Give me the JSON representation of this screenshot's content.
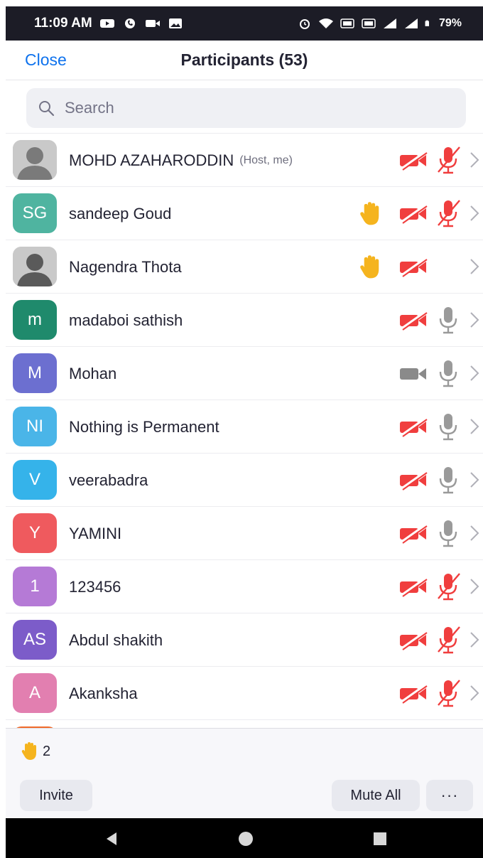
{
  "status_bar": {
    "time": "11:09 AM",
    "battery": "79%"
  },
  "header": {
    "close_label": "Close",
    "title": "Participants (53)"
  },
  "search": {
    "placeholder": "Search"
  },
  "participants": [
    {
      "name": "MOHD AZAHARODDIN",
      "tag": "(Host, me)",
      "initials": "",
      "avatar": "photo",
      "color": "#7a7a7a",
      "hand": false,
      "video": "off",
      "audio": "muted"
    },
    {
      "name": "sandeep Goud",
      "tag": "",
      "initials": "SG",
      "avatar": "initials",
      "color": "#4fb4a0",
      "hand": true,
      "video": "off",
      "audio": "muted"
    },
    {
      "name": "Nagendra Thota",
      "tag": "",
      "initials": "",
      "avatar": "photo",
      "color": "#5a5a5a",
      "hand": true,
      "video": "off",
      "audio": "none"
    },
    {
      "name": "madaboi sathish",
      "tag": "",
      "initials": "m",
      "avatar": "initials",
      "color": "#1f8a6c",
      "hand": false,
      "video": "off",
      "audio": "on"
    },
    {
      "name": "Mohan",
      "tag": "",
      "initials": "M",
      "avatar": "initials",
      "color": "#6c6fd0",
      "hand": false,
      "video": "on",
      "audio": "on"
    },
    {
      "name": "Nothing is Permanent",
      "tag": "",
      "initials": "NI",
      "avatar": "initials",
      "color": "#4ab5e8",
      "hand": false,
      "video": "off",
      "audio": "on"
    },
    {
      "name": "veerabadra",
      "tag": "",
      "initials": "V",
      "avatar": "initials",
      "color": "#35b3ea",
      "hand": false,
      "video": "off",
      "audio": "on"
    },
    {
      "name": "YAMINI",
      "tag": "",
      "initials": "Y",
      "avatar": "initials",
      "color": "#ef5a5e",
      "hand": false,
      "video": "off",
      "audio": "on"
    },
    {
      "name": "123456",
      "tag": "",
      "initials": "1",
      "avatar": "initials",
      "color": "#b57ad6",
      "hand": false,
      "video": "off",
      "audio": "muted"
    },
    {
      "name": "Abdul shakith",
      "tag": "",
      "initials": "AS",
      "avatar": "initials",
      "color": "#7c5cc9",
      "hand": false,
      "video": "off",
      "audio": "muted"
    },
    {
      "name": "Akanksha",
      "tag": "",
      "initials": "A",
      "avatar": "initials",
      "color": "#e27fb0",
      "hand": false,
      "video": "off",
      "audio": "muted"
    },
    {
      "name": "",
      "tag": "",
      "initials": "",
      "avatar": "initials",
      "color": "#f06a2a",
      "hand": false,
      "video": "none",
      "audio": "none"
    }
  ],
  "footer": {
    "raised_hands": "2",
    "invite_label": "Invite",
    "mute_all_label": "Mute All",
    "more_label": "···"
  },
  "colors": {
    "accent": "#0e72ed",
    "muted_red": "#f03e3e",
    "hand_yellow": "#f5b41e",
    "icon_gray": "#9a9a9a"
  }
}
